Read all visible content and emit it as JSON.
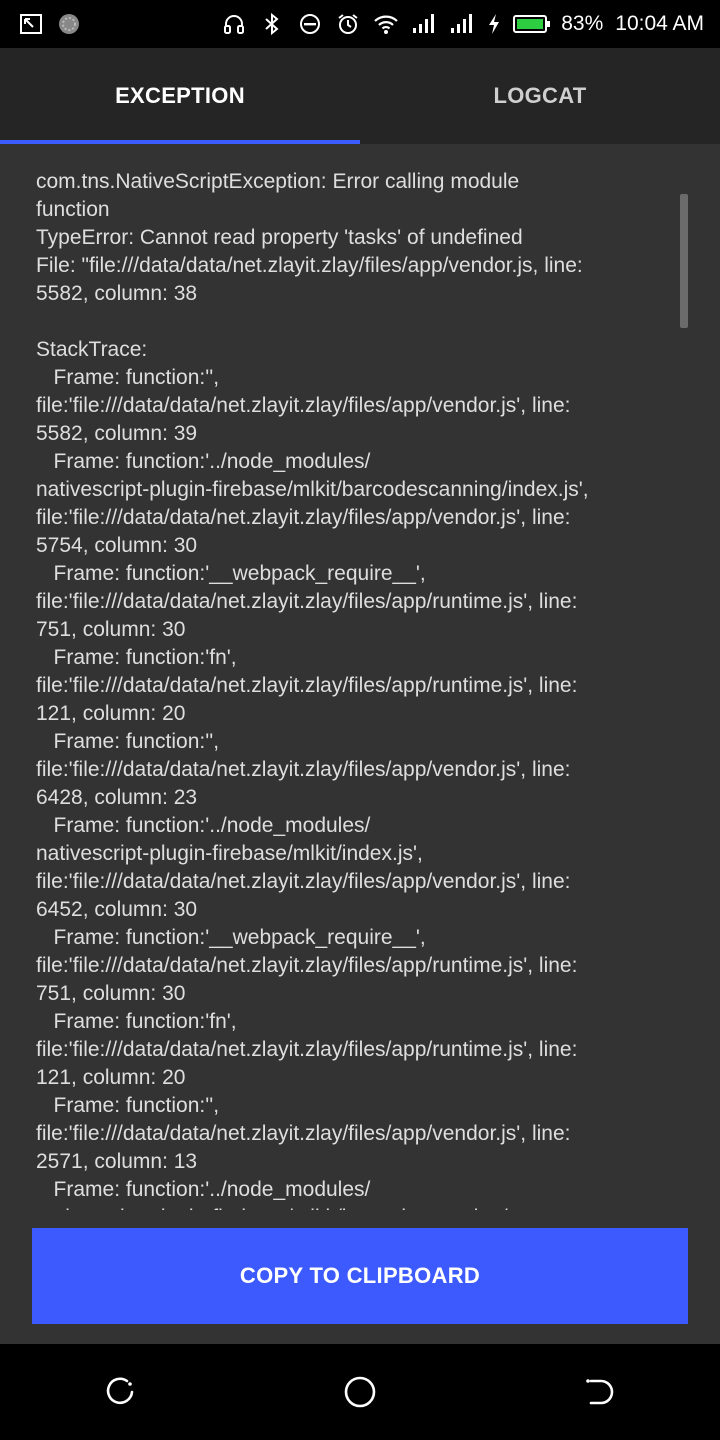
{
  "status_bar": {
    "battery_percent": "83%",
    "time": "10:04 AM"
  },
  "tabs": [
    {
      "label": "EXCEPTION",
      "active": true
    },
    {
      "label": "LOGCAT",
      "active": false
    }
  ],
  "log_text": "com.tns.NativeScriptException: Error calling module\nfunction\nTypeError: Cannot read property 'tasks' of undefined\nFile: \"file:///data/data/net.zlayit.zlay/files/app/vendor.js, line:\n5582, column: 38\n\nStackTrace:\n   Frame: function:'',\nfile:'file:///data/data/net.zlayit.zlay/files/app/vendor.js', line:\n5582, column: 39\n   Frame: function:'../node_modules/\nnativescript-plugin-firebase/mlkit/barcodescanning/index.js',\nfile:'file:///data/data/net.zlayit.zlay/files/app/vendor.js', line:\n5754, column: 30\n   Frame: function:'__webpack_require__',\nfile:'file:///data/data/net.zlayit.zlay/files/app/runtime.js', line:\n751, column: 30\n   Frame: function:'fn',\nfile:'file:///data/data/net.zlayit.zlay/files/app/runtime.js', line:\n121, column: 20\n   Frame: function:'',\nfile:'file:///data/data/net.zlayit.zlay/files/app/vendor.js', line:\n6428, column: 23\n   Frame: function:'../node_modules/\nnativescript-plugin-firebase/mlkit/index.js',\nfile:'file:///data/data/net.zlayit.zlay/files/app/vendor.js', line:\n6452, column: 30\n   Frame: function:'__webpack_require__',\nfile:'file:///data/data/net.zlayit.zlay/files/app/runtime.js', line:\n751, column: 30\n   Frame: function:'fn',\nfile:'file:///data/data/net.zlayit.zlay/files/app/runtime.js', line:\n121, column: 20\n   Frame: function:'',\nfile:'file:///data/data/net.zlayit.zlay/files/app/vendor.js', line:\n2571, column: 13\n   Frame: function:'../node_modules/\nnativescript-plugin-firebase/mlkit/barcodescanning/",
  "footer": {
    "copy_label": "COPY TO CLIPBOARD"
  },
  "colors": {
    "accent": "#3d5afe",
    "tab_bar": "#252525",
    "content_bg": "#333333"
  },
  "icons": {
    "status_left": [
      "screenshot-icon",
      "loading-icon"
    ],
    "status_right": [
      "headphones-icon",
      "bluetooth-icon",
      "do-not-disturb-icon",
      "alarm-icon",
      "wifi-icon",
      "signal-icon",
      "signal-icon",
      "charging-icon",
      "battery-icon"
    ],
    "nav": [
      "recents-icon",
      "home-icon",
      "back-icon"
    ]
  }
}
